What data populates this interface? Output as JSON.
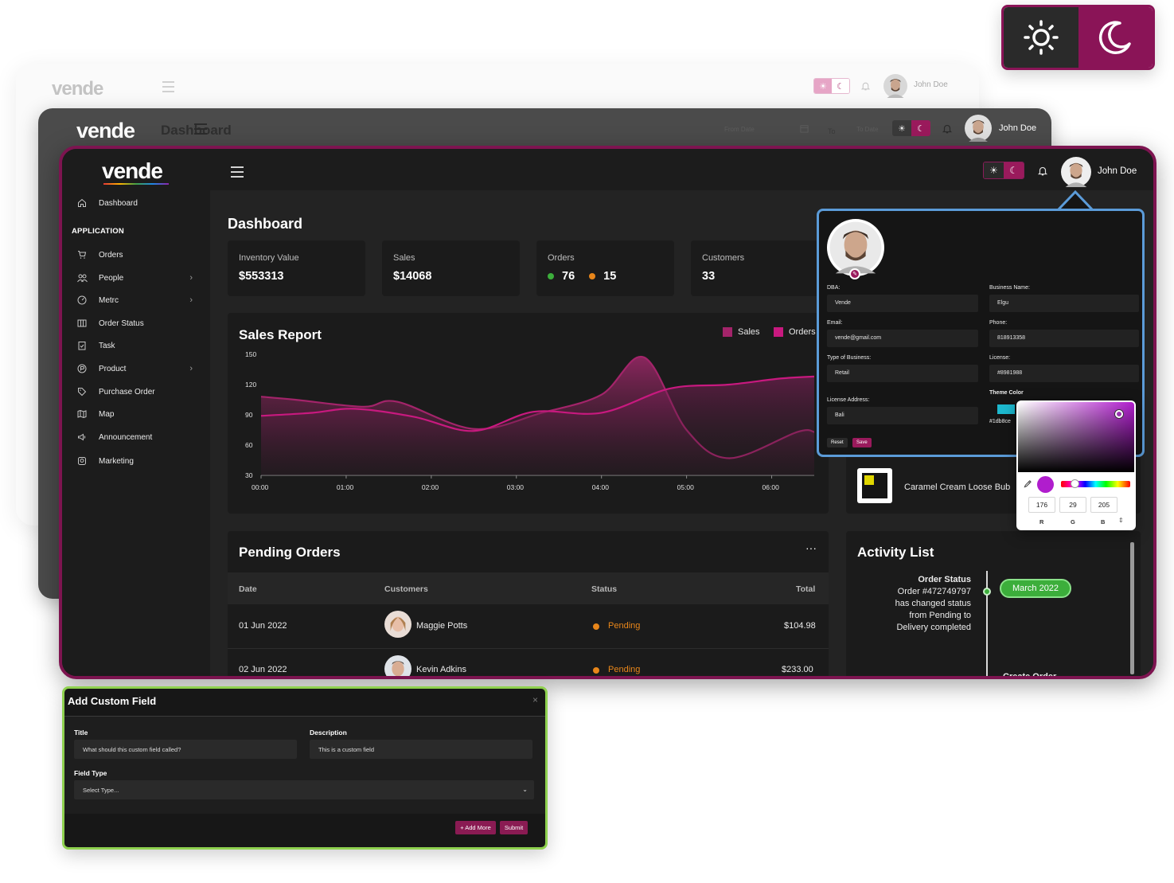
{
  "colors": {
    "accent": "#9a1a5c",
    "sales_series": "#a3246a",
    "orders_series": "#c8197f",
    "pending": "#e8861a",
    "green": "#3cae3b",
    "orange": "#e8861a"
  },
  "theme_toggle": {
    "light_icon": "sun-icon",
    "dark_icon": "moon-icon",
    "active": "dark"
  },
  "back_window": {
    "logo": "vende",
    "user_name": "John Doe"
  },
  "mid_window": {
    "logo": "vende",
    "title": "Dashboard",
    "from_date_placeholder": "From Date",
    "to_label": "To",
    "to_date_placeholder": "To Date",
    "user_name": "John Doe"
  },
  "app": {
    "logo": "vende",
    "user_name": "John Doe",
    "sidebar": {
      "top_item": {
        "label": "Dashboard",
        "icon": "home-icon"
      },
      "section_label": "APPLICATION",
      "items": [
        {
          "label": "Orders",
          "icon": "cart-icon",
          "has_submenu": false
        },
        {
          "label": "People",
          "icon": "people-icon",
          "has_submenu": true
        },
        {
          "label": "Metrc",
          "icon": "gauge-icon",
          "has_submenu": true
        },
        {
          "label": "Order Status",
          "icon": "columns-icon",
          "has_submenu": false
        },
        {
          "label": "Task",
          "icon": "clipboard-icon",
          "has_submenu": false
        },
        {
          "label": "Product",
          "icon": "product-icon",
          "has_submenu": true
        },
        {
          "label": "Purchase Order",
          "icon": "tag-icon",
          "has_submenu": false
        },
        {
          "label": "Map",
          "icon": "map-icon",
          "has_submenu": false
        },
        {
          "label": "Announcement",
          "icon": "megaphone-icon",
          "has_submenu": false
        },
        {
          "label": "Marketing",
          "icon": "marketing-icon",
          "has_submenu": false
        }
      ]
    },
    "page_title": "Dashboard",
    "stats": [
      {
        "label": "Inventory Value",
        "value": "$553313"
      },
      {
        "label": "Sales",
        "value": "$14068"
      },
      {
        "label": "Orders",
        "value_green": "76",
        "value_orange": "15"
      },
      {
        "label": "Customers",
        "value": "33"
      }
    ]
  },
  "chart_data": {
    "type": "area",
    "title": "Sales Report",
    "x": [
      "00:00",
      "01:00",
      "02:00",
      "03:00",
      "04:00",
      "05:00",
      "06:00"
    ],
    "ylim": [
      30,
      150
    ],
    "yticks": [
      150,
      120,
      90,
      60,
      30
    ],
    "series": [
      {
        "name": "Sales",
        "values": [
          [
            0,
            108
          ],
          [
            0.4,
            105
          ],
          [
            1.2,
            98
          ],
          [
            1.6,
            103
          ],
          [
            2.5,
            76
          ],
          [
            3.3,
            92
          ],
          [
            4.0,
            110
          ],
          [
            4.5,
            147
          ],
          [
            5.0,
            75
          ],
          [
            5.5,
            47
          ],
          [
            6.3,
            73
          ],
          [
            6.5,
            73
          ]
        ]
      },
      {
        "name": "Orders",
        "values": [
          [
            0,
            89
          ],
          [
            0.6,
            92
          ],
          [
            1.1,
            96
          ],
          [
            1.8,
            88
          ],
          [
            2.5,
            74
          ],
          [
            3.2,
            93
          ],
          [
            4.0,
            92
          ],
          [
            4.8,
            116
          ],
          [
            5.5,
            120
          ],
          [
            6.1,
            126
          ],
          [
            6.5,
            128
          ]
        ]
      }
    ],
    "legend": "top-right"
  },
  "pending_orders": {
    "title": "Pending Orders",
    "menu_label": "···",
    "columns": [
      "Date",
      "Customers",
      "Status",
      "Total"
    ],
    "rows": [
      {
        "date": "01 Jun 2022",
        "customer": "Maggie Potts",
        "status": "Pending",
        "total": "$104.98"
      },
      {
        "date": "02 Jun 2022",
        "customer": "Kevin Adkins",
        "status": "Pending",
        "total": "$233.00"
      }
    ]
  },
  "product_item": {
    "name": "Caramel Cream Loose Bub"
  },
  "activity_list": {
    "title": "Activity List",
    "item_title": "Order Status",
    "item_lines": [
      "Order #472749797",
      "has changed status",
      "from Pending to",
      "Delivery completed"
    ],
    "date_pill": "March 2022",
    "next_item_title": "Create Order"
  },
  "profile_popup": {
    "fields": [
      {
        "label": "DBA:",
        "value": "Vende"
      },
      {
        "label": "Business Name:",
        "value": "Elgu"
      },
      {
        "label": "Email:",
        "value": "vende@gmail.com"
      },
      {
        "label": "Phone:",
        "value": "818913358"
      },
      {
        "label": "Type of Business:",
        "value": "Retail"
      },
      {
        "label": "License:",
        "value": "#8981988"
      },
      {
        "label": "License Address:",
        "value": "Bali"
      }
    ],
    "theme_color_label": "Theme Color",
    "theme_color_value": "#1db8ce",
    "reset_label": "Reset",
    "save_label": "Save"
  },
  "color_picker": {
    "r": "176",
    "g": "29",
    "b": "205",
    "r_label": "R",
    "g_label": "G",
    "b_label": "B",
    "selected_color": "#b01dcd"
  },
  "custom_field_modal": {
    "title": "Add Custom Field",
    "close_label": "×",
    "title_label": "Title",
    "title_placeholder": "What should this custom field called?",
    "description_label": "Description",
    "description_value": "This is a custom field",
    "field_type_label": "Field Type",
    "field_type_placeholder": "Select Type...",
    "add_more_label": "+ Add More",
    "submit_label": "Submit"
  }
}
